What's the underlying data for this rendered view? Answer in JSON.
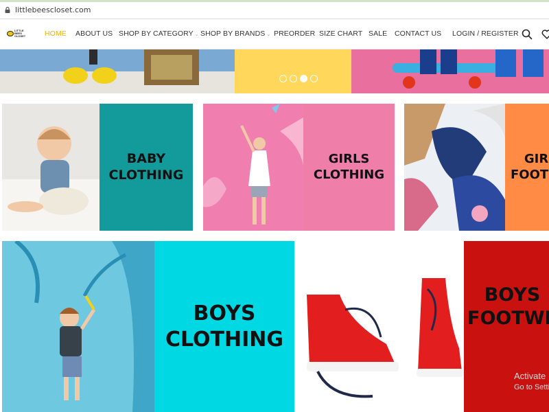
{
  "browser": {
    "url": "littlebeescloset.com"
  },
  "header": {
    "logo_text": "LITTLE BEES CLOSET",
    "nav": [
      {
        "label": "HOME",
        "active": true
      },
      {
        "label": "ABOUT US"
      },
      {
        "label": "SHOP BY CATEGORY",
        "dropdown": true
      },
      {
        "label": "SHOP BY BRANDS",
        "dropdown": true
      },
      {
        "label": "PREORDER"
      },
      {
        "label": "SIZE CHART"
      },
      {
        "label": "SALE"
      },
      {
        "label": "CONTACT US"
      }
    ],
    "login_label": "LOGIN / REGISTER",
    "accent_color": "#f0b400"
  },
  "slider": {
    "dots": 4,
    "active_dot": 3
  },
  "categories": {
    "baby": {
      "label": "BABY\nCLOTHING",
      "panel_color": "#139a9a"
    },
    "girls": {
      "label": "GIRLS\nCLOTHING",
      "panel_color": "#ef7fa9"
    },
    "girls_footwear": {
      "label": "GIR\nFOOTW",
      "panel_color": "#ff8b45"
    },
    "boys": {
      "label": "BOYS\nCLOTHING",
      "panel_color": "#00d8e3"
    },
    "boys_footwear": {
      "label": "BOYS\nFOOTWE",
      "panel_color": "#c9120f"
    }
  },
  "watermark": {
    "line1": "Activate",
    "line2": "Go to Setti"
  }
}
